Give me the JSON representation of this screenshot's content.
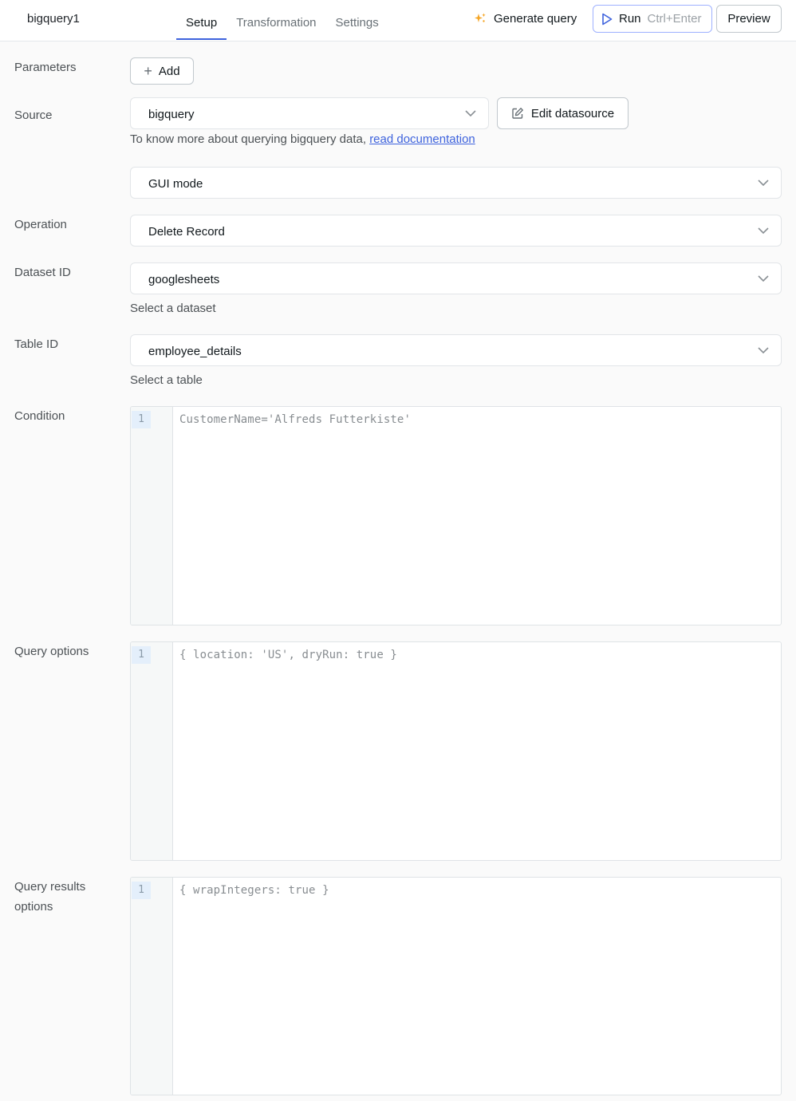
{
  "header": {
    "query_name": "bigquery1",
    "tabs": [
      {
        "label": "Setup",
        "active": true
      },
      {
        "label": "Transformation",
        "active": false
      },
      {
        "label": "Settings",
        "active": false
      }
    ],
    "generate_query_label": "Generate query",
    "run_label": "Run",
    "run_shortcut": "Ctrl+Enter",
    "preview_label": "Preview",
    "accent_color": "#3e63dd"
  },
  "form": {
    "parameters": {
      "label": "Parameters",
      "add_label": "Add"
    },
    "source": {
      "label": "Source",
      "value": "bigquery",
      "edit_label": "Edit datasource",
      "help_text": "To know more about querying bigquery data, ",
      "help_link": "read documentation"
    },
    "mode": {
      "value": "GUI mode"
    },
    "operation": {
      "label": "Operation",
      "value": "Delete Record"
    },
    "dataset": {
      "label": "Dataset ID",
      "value": "googlesheets",
      "help": "Select a dataset"
    },
    "table": {
      "label": "Table ID",
      "value": "employee_details",
      "help": "Select a table"
    },
    "condition": {
      "label": "Condition",
      "line_number": "1",
      "code": "CustomerName='Alfreds Futterkiste'"
    },
    "query_options": {
      "label": "Query options",
      "line_number": "1",
      "code": "{ location: 'US', dryRun: true }"
    },
    "query_results_options": {
      "label_line1": "Query results",
      "label_line2": "options",
      "line_number": "1",
      "code": "{ wrapIntegers: true }"
    }
  }
}
